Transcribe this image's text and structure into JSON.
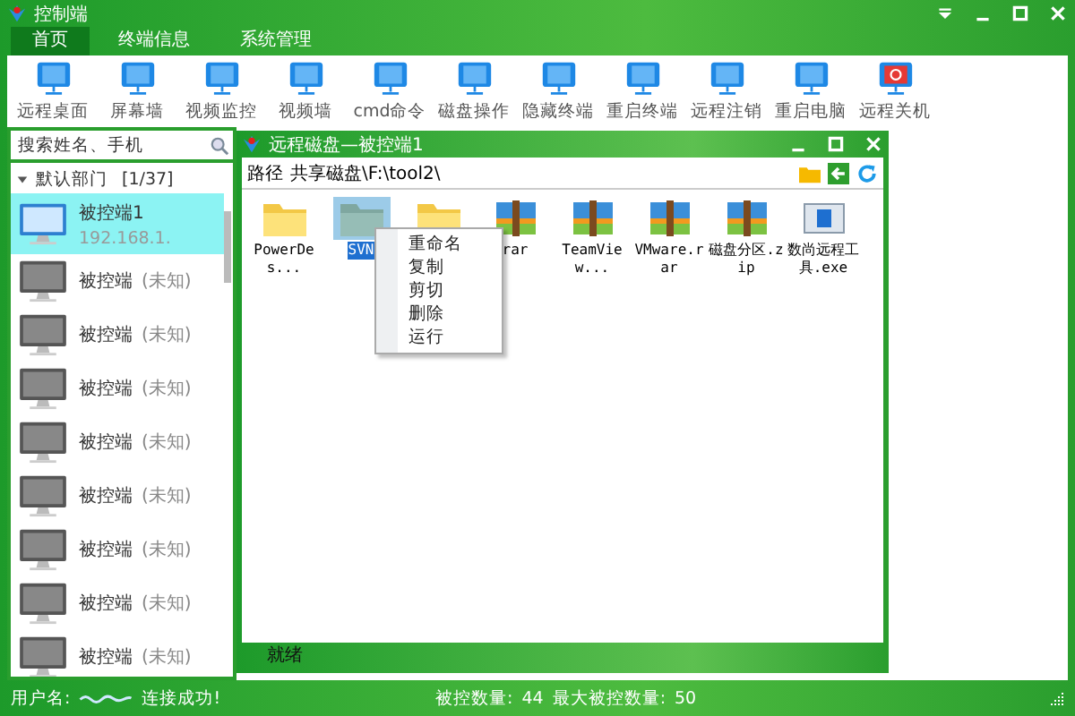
{
  "window": {
    "title": "控制端"
  },
  "tabs": [
    {
      "label": "首页",
      "selected": true
    },
    {
      "label": "终端信息",
      "selected": false
    },
    {
      "label": "系统管理",
      "selected": false
    }
  ],
  "toolbar": [
    {
      "label": "远程桌面"
    },
    {
      "label": "屏幕墙"
    },
    {
      "label": "视频监控"
    },
    {
      "label": "视频墙"
    },
    {
      "label": "cmd命令"
    },
    {
      "label": "磁盘操作"
    },
    {
      "label": "隐藏终端"
    },
    {
      "label": "重启终端"
    },
    {
      "label": "远程注销"
    },
    {
      "label": "重启电脑"
    },
    {
      "label": "远程关机",
      "kind": "danger"
    }
  ],
  "search": {
    "placeholder": "搜索姓名、手机"
  },
  "group": {
    "label": "默认部门",
    "count": "[1/37]",
    "expanded": true
  },
  "clients": [
    {
      "name": "被控端1",
      "ip": "192.168.1.",
      "selected": true
    },
    {
      "name": "被控端",
      "status": "(未知)",
      "selected": false
    },
    {
      "name": "被控端",
      "status": "(未知)",
      "selected": false
    },
    {
      "name": "被控端",
      "status": "(未知)",
      "selected": false
    },
    {
      "name": "被控端",
      "status": "(未知)",
      "selected": false
    },
    {
      "name": "被控端",
      "status": "(未知)",
      "selected": false
    },
    {
      "name": "被控端",
      "status": "(未知)",
      "selected": false
    },
    {
      "name": "被控端",
      "status": "(未知)",
      "selected": false
    },
    {
      "name": "被控端",
      "status": "(未知)",
      "selected": false
    }
  ],
  "remote_window": {
    "title": "远程磁盘—被控端1",
    "path_label": "路径",
    "path": "共享磁盘\\F:\\tool2\\",
    "files": [
      {
        "kind": "folder",
        "label": "PowerDes...",
        "selected": false
      },
      {
        "kind": "folder",
        "label": "SVN",
        "selected": true
      },
      {
        "kind": "folder",
        "selected": false
      },
      {
        "kind": "archive",
        "label": "rar",
        "selected": false
      },
      {
        "kind": "archive",
        "label": "TeamView...",
        "selected": false
      },
      {
        "kind": "archive",
        "label": "VMware.rar",
        "selected": false
      },
      {
        "kind": "archive",
        "label": "磁盘分区.zip",
        "selected": false
      },
      {
        "kind": "exe",
        "label": "数尚远程工具.exe",
        "selected": false
      }
    ],
    "context_menu": [
      "重命名",
      "复制",
      "剪切",
      "删除",
      "运行"
    ],
    "status": "就绪"
  },
  "status_bar": {
    "user_label": "用户名:",
    "connection": "连接成功!",
    "count_label": "被控数量:",
    "count": "44",
    "max_label": "最大被控数量:",
    "max": "50"
  }
}
